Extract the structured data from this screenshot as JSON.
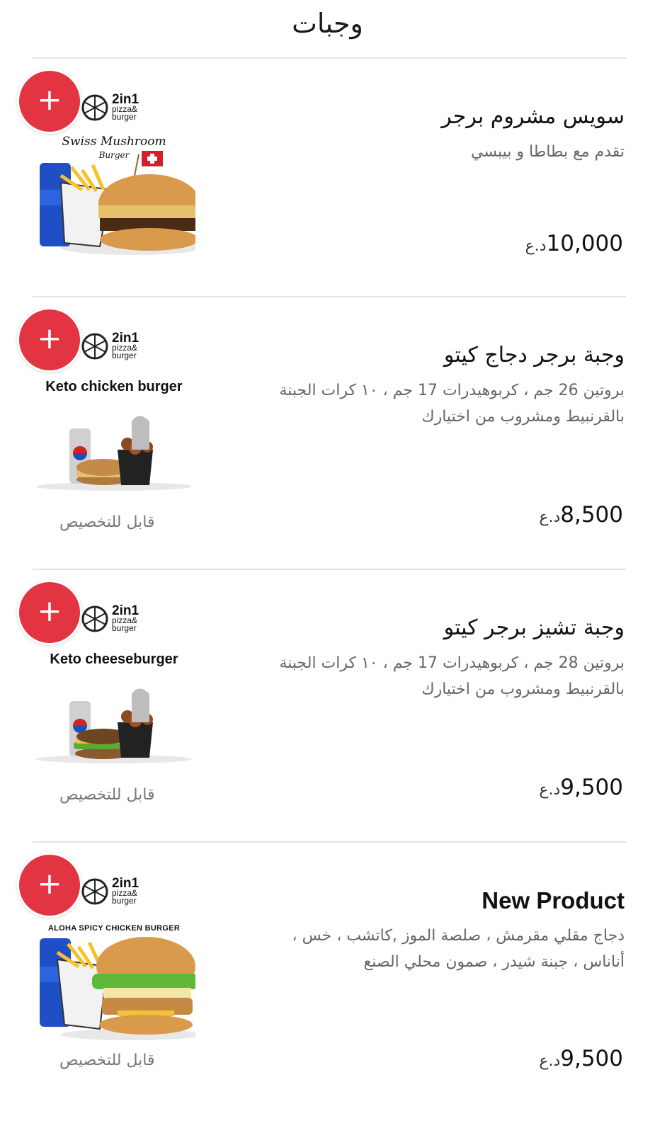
{
  "header": {
    "title": "وجبات"
  },
  "currency": "د.ع",
  "brand": {
    "name": "2in1",
    "sub1": "pizza&",
    "sub2": "burger"
  },
  "add_symbol": "+",
  "items": [
    {
      "name": "سويس مشروم برجر",
      "description": "تقدم مع بطاطا و بيبسي",
      "price": "10,000",
      "customizable": "",
      "image_label": "Swiss Mushroom",
      "image_sublabel": "Burger"
    },
    {
      "name": "وجبة برجر دجاج كيتو",
      "description": "بروتين 26 جم ، كربوهيدرات 17 جم ، ١٠ كرات الجبنة بالقرنبيط ومشروب من اختيارك",
      "price": "8,500",
      "customizable": "قابل للتخصيص",
      "image_label": "Keto chicken burger",
      "image_sublabel": ""
    },
    {
      "name": "وجبة تشيز برجر كيتو",
      "description": "بروتين 28 جم ، كربوهيدرات 17 جم ، ١٠ كرات الجبنة بالقرنبيط ومشروب من اختيارك",
      "price": "9,500",
      "customizable": "قابل للتخصيص",
      "image_label": "Keto cheeseburger",
      "image_sublabel": ""
    },
    {
      "name": "New Product",
      "description": "دجاج مقلي مقرمش ، صلصة الموز ,كاتشب ، خس ، أناناس ، جبنة شيدر ، صمون محلي الصنع",
      "price": "9,500",
      "customizable": "قابل للتخصيص",
      "image_label": "ALOHA SPICY CHICKEN BURGER",
      "image_sublabel": ""
    }
  ]
}
